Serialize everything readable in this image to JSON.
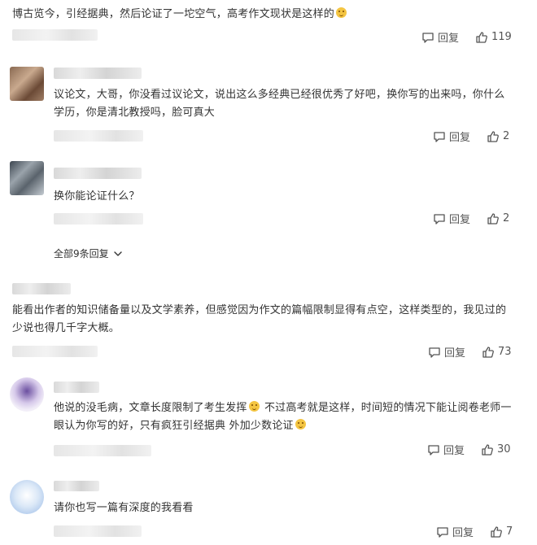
{
  "comments": [
    {
      "text": "博古览今，引经据典，然后论证了一坨空气，高考作文现状是这样的",
      "reply_label": "回复",
      "likes": "119"
    },
    {
      "text": "议论文，大哥，你没看过议论文，说出这么多经典已经很优秀了好吧，换你写的出来吗，你什么学历，你是清北教授吗，脸可真大",
      "reply_label": "回复",
      "likes": "2"
    },
    {
      "text": "换你能论证什么？",
      "reply_label": "回复",
      "likes": "2"
    },
    {
      "text": "能看出作者的知识储备量以及文学素养，但感觉因为作文的篇幅限制显得有点空，这样类型的，我见过的少说也得几千字大概。",
      "reply_label": "回复",
      "likes": "73"
    },
    {
      "text_a": "他说的没毛病，文章长度限制了考生发挥",
      "text_b": "不过高考就是这样，时间短的情况下能让阅卷老师一眼认为你写的好，只有疯狂引经据典 外加少数论证",
      "reply_label": "回复",
      "likes": "30"
    },
    {
      "text": "请你也写一篇有深度的我看看",
      "reply_label": "回复",
      "likes": "7"
    }
  ],
  "thread": {
    "more_replies_label": "全部9条回复"
  },
  "icons": {
    "reply": "comment-bubble-icon",
    "like": "thumbs-up-icon",
    "expand": "chevron-down-icon",
    "emoji": "smiley-emoji-icon"
  },
  "colors": {
    "text": "#333333",
    "meta": "#555555",
    "blur": "#d9d9d9"
  }
}
